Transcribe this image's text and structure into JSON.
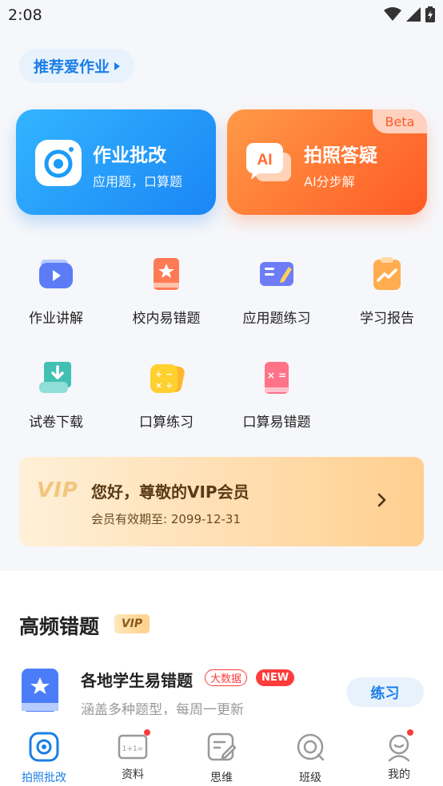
{
  "status_bar": {
    "time": "2:08"
  },
  "recommend": {
    "label": "推荐爱作业"
  },
  "cards": [
    {
      "title": "作业批改",
      "subtitle": "应用题，口算题",
      "icon": "camera-icon",
      "color": "#1a86f5"
    },
    {
      "title": "拍照答疑",
      "subtitle": "AI分步解",
      "badge": "Beta",
      "icon": "ai-chat-icon",
      "icon_text": "AI",
      "color": "#ff5a24"
    }
  ],
  "features": [
    {
      "label": "作业讲解",
      "icon": "video-play-icon"
    },
    {
      "label": "校内易错题",
      "icon": "book-star-icon"
    },
    {
      "label": "应用题练习",
      "icon": "notebook-pen-icon"
    },
    {
      "label": "学习报告",
      "icon": "report-chart-icon"
    },
    {
      "label": "试卷下载",
      "icon": "download-scroll-icon"
    },
    {
      "label": "口算练习",
      "icon": "calculator-icon"
    },
    {
      "label": "口算易错题",
      "icon": "math-error-book-icon"
    }
  ],
  "vip": {
    "logo": "VIP",
    "greeting": "您好，尊敬的VIP会员",
    "expire": "会员有效期至: 2099-12-31"
  },
  "section": {
    "title": "高频错题",
    "badge": "VIP",
    "item": {
      "title": "各地学生易错题",
      "tag_big": "大数据",
      "tag_new": "NEW",
      "subtitle": "涵盖多种题型，每周一更新",
      "button": "练习"
    }
  },
  "tabs": [
    {
      "label": "拍照批改",
      "icon": "camera-tab-icon",
      "active": true
    },
    {
      "label": "资料",
      "icon": "book-tab-icon",
      "icon_text": "1+1=",
      "dot": true
    },
    {
      "label": "思维",
      "icon": "pencil-note-tab-icon"
    },
    {
      "label": "班级",
      "icon": "class-tab-icon"
    },
    {
      "label": "我的",
      "icon": "profile-tab-icon",
      "dot": true
    }
  ],
  "colors": {
    "accent": "#1b7ee8",
    "orange": "#ff5a24",
    "alert": "#ff3b3b"
  }
}
